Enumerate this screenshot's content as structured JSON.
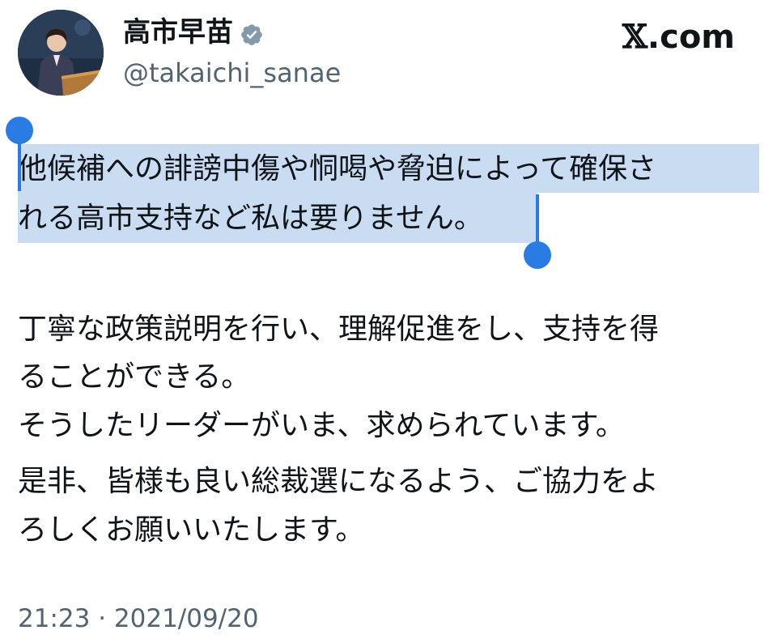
{
  "author": {
    "display_name": "高市早苗",
    "handle": "@takaichi_sanae",
    "verified": true,
    "avatar_icon": "profile-photo"
  },
  "brand": {
    "x_glyph": "𝕏",
    "suffix": ".com"
  },
  "tweet": {
    "selected_lines": [
      "他候補への誹謗中傷や恫喝や脅迫によって確保さ",
      "れる高市支持など私は要りません。"
    ],
    "body_lines": [
      "丁寧な政策説明を行い、理解促進をし、支持を得",
      "ることができる。",
      "そうしたリーダーがいま、求められています。",
      "是非、皆様も良い総裁選になるよう、ご協力をよ",
      "ろしくお願いいたします。"
    ]
  },
  "timestamp": "21:23 · 2021/09/20",
  "colors": {
    "selection": "#c9dcf1",
    "selection_handle": "#2b7be4",
    "secondary_text": "#536471",
    "verified_badge": "#829aab"
  }
}
